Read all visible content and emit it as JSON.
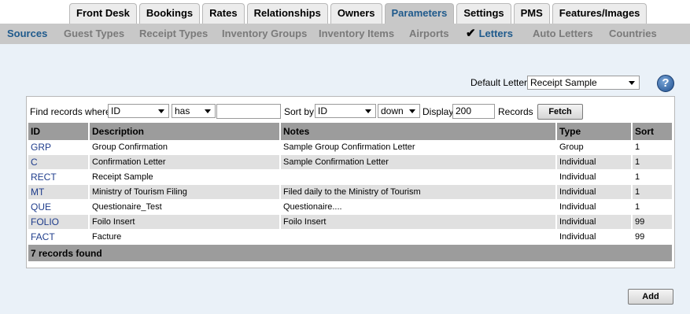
{
  "top_tabs": [
    {
      "label": "Front Desk",
      "active": false
    },
    {
      "label": "Bookings",
      "active": false
    },
    {
      "label": "Rates",
      "active": false
    },
    {
      "label": "Relationships",
      "active": false
    },
    {
      "label": "Owners",
      "active": false
    },
    {
      "label": "Parameters",
      "active": true
    },
    {
      "label": "Settings",
      "active": false
    },
    {
      "label": "PMS",
      "active": false
    },
    {
      "label": "Features/Images",
      "active": false
    }
  ],
  "sub_nav": [
    {
      "label": "Sources",
      "active": true
    },
    {
      "label": "Guest Types",
      "active": false
    },
    {
      "label": "Receipt Types",
      "active": false
    },
    {
      "label": "Inventory Groups",
      "active": false
    },
    {
      "label": "Inventory Items",
      "active": false
    },
    {
      "label": "Airports",
      "active": false
    },
    {
      "label": "Letters",
      "active": true,
      "checked": true
    },
    {
      "label": "Auto Letters",
      "active": false
    },
    {
      "label": "Countries",
      "active": false
    }
  ],
  "default_letter": {
    "label": "Default Letter:",
    "value": "Receipt Sample"
  },
  "help_icon": "?",
  "filter": {
    "find_label": "Find records where",
    "field_value": "ID",
    "operator_value": "has",
    "search_value": "",
    "sort_label": "Sort by",
    "sort_value": "ID",
    "direction_value": "down",
    "display_label": "Display",
    "display_value": "200",
    "records_label": "Records",
    "fetch_label": "Fetch"
  },
  "table": {
    "columns": [
      "ID",
      "Description",
      "Notes",
      "Type",
      "Sort"
    ],
    "rows": [
      [
        "GRP",
        "Group Confirmation",
        "Sample Group Confirmation Letter",
        "Group",
        "1"
      ],
      [
        "C",
        "Confirmation Letter",
        "Sample Confirmation Letter",
        "Individual",
        "1"
      ],
      [
        "RECT",
        "Receipt Sample",
        "",
        "Individual",
        "1"
      ],
      [
        "MT",
        "Ministry of Tourism Filing",
        "Filed daily to the Ministry of Tourism",
        "Individual",
        "1"
      ],
      [
        "QUE",
        "Questionaire_Test",
        "Questionaire....",
        "Individual",
        "1"
      ],
      [
        "FOLIO",
        "Foilo Insert",
        "Foilo Insert",
        "Individual",
        "99"
      ],
      [
        "FACT",
        "Facture",
        "",
        "Individual",
        "99"
      ]
    ],
    "footer": "7 records found"
  },
  "add_label": "Add",
  "colors": {
    "accent": "#1f5a8c",
    "link": "#1f3d8c",
    "header_gray": "#9c9c9c",
    "background": "#eaf1f8"
  }
}
